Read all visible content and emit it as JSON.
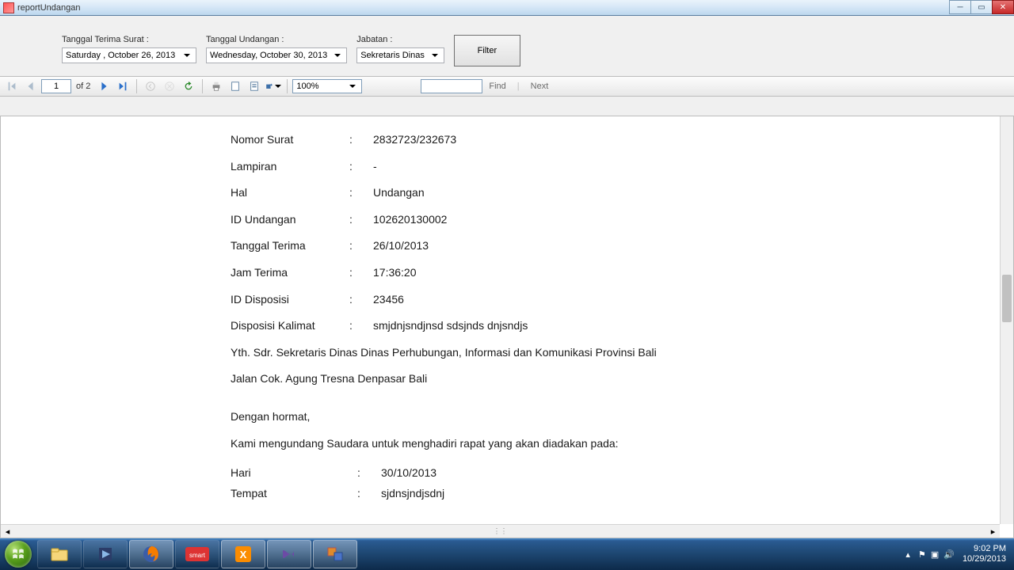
{
  "window": {
    "title": "reportUndangan"
  },
  "filters": {
    "tanggal_terima": {
      "label": "Tanggal Terima Surat :",
      "value": "Saturday  ,  October   26, 2013"
    },
    "tanggal_undangan": {
      "label": "Tanggal Undangan :",
      "value": "Wednesday,  October   30, 2013"
    },
    "jabatan": {
      "label": "Jabatan :",
      "value": "Sekretaris Dinas"
    },
    "filter_button": "Filter"
  },
  "toolbar": {
    "page_current": "1",
    "page_total_prefix": "of",
    "page_total": "2",
    "zoom": "100%",
    "find": "Find",
    "next": "Next"
  },
  "report": {
    "rows": [
      {
        "label": "Nomor Surat",
        "value": "2832723/232673"
      },
      {
        "label": "Lampiran",
        "value": "-"
      },
      {
        "label": "Hal",
        "value": "Undangan"
      },
      {
        "label": "ID Undangan",
        "value": "102620130002"
      },
      {
        "label": "Tanggal Terima",
        "value": "26/10/2013"
      },
      {
        "label": "Jam Terima",
        "value": "17:36:20"
      },
      {
        "label": "ID Disposisi",
        "value": "23456"
      },
      {
        "label": "Disposisi Kalimat",
        "value": "smjdnjsndjnsd sdsjnds dnjsndjs"
      }
    ],
    "yth": "Yth. Sdr.    Sekretaris Dinas Dinas Perhubungan, Informasi dan Komunikasi Provinsi Bali",
    "alamat": "Jalan Cok. Agung Tresna Denpasar Bali",
    "salam": "Dengan hormat,",
    "isi": "Kami mengundang Saudara untuk menghadiri rapat yang akan diadakan pada:",
    "detail": [
      {
        "label": "Hari",
        "value": "30/10/2013"
      },
      {
        "label": "Tempat",
        "value": "sjdnsjndjsdnj"
      }
    ]
  },
  "taskbar": {
    "time": "9:02 PM",
    "date": "10/29/2013"
  }
}
